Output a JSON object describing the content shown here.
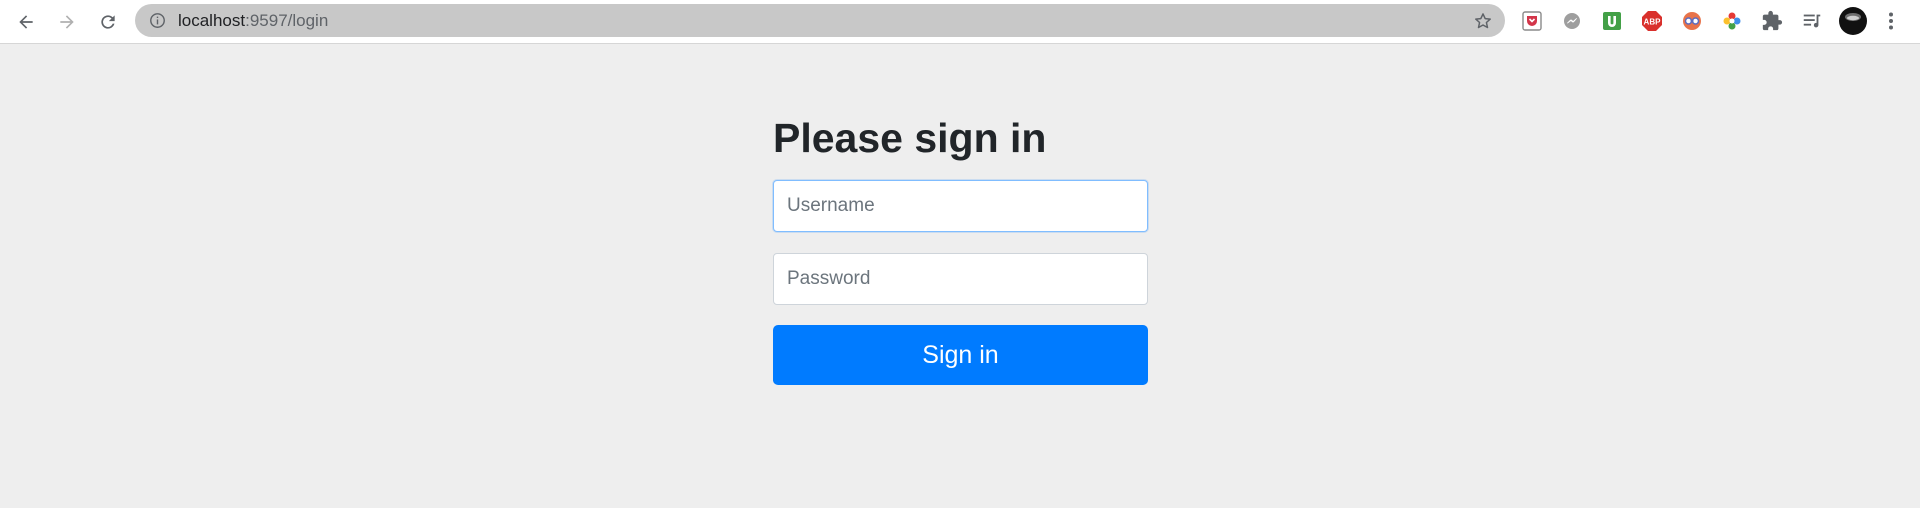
{
  "browser": {
    "url_host": "localhost",
    "url_path": ":9597/login",
    "nav": {
      "back_icon": "arrow-left-icon",
      "forward_icon": "arrow-right-icon",
      "reload_icon": "reload-icon"
    },
    "extensions": [
      {
        "name": "pocket-extension-icon",
        "color": "#d3354a"
      },
      {
        "name": "messenger-extension-icon",
        "color": "#9e9e9e"
      },
      {
        "name": "ublock-extension-icon",
        "color": "#4caf50"
      },
      {
        "name": "adblock-plus-extension-icon",
        "color": "#d9302c",
        "label": "ABP"
      },
      {
        "name": "mask-extension-icon",
        "color": "#e8734a"
      },
      {
        "name": "colorful-extension-icon",
        "color": "#3f8ee8"
      },
      {
        "name": "puzzle-extensions-icon",
        "color": "#5f6368"
      },
      {
        "name": "reading-list-icon",
        "color": "#5f6368"
      },
      {
        "name": "profile-avatar-icon",
        "color": "#111111"
      },
      {
        "name": "menu-kebab-icon",
        "color": "#5f6368"
      }
    ]
  },
  "login": {
    "title": "Please sign in",
    "username_placeholder": "Username",
    "password_placeholder": "Password",
    "submit_label": "Sign in"
  },
  "colors": {
    "page_bg": "#eeeeee",
    "primary": "#007bff",
    "heading": "#212529"
  }
}
